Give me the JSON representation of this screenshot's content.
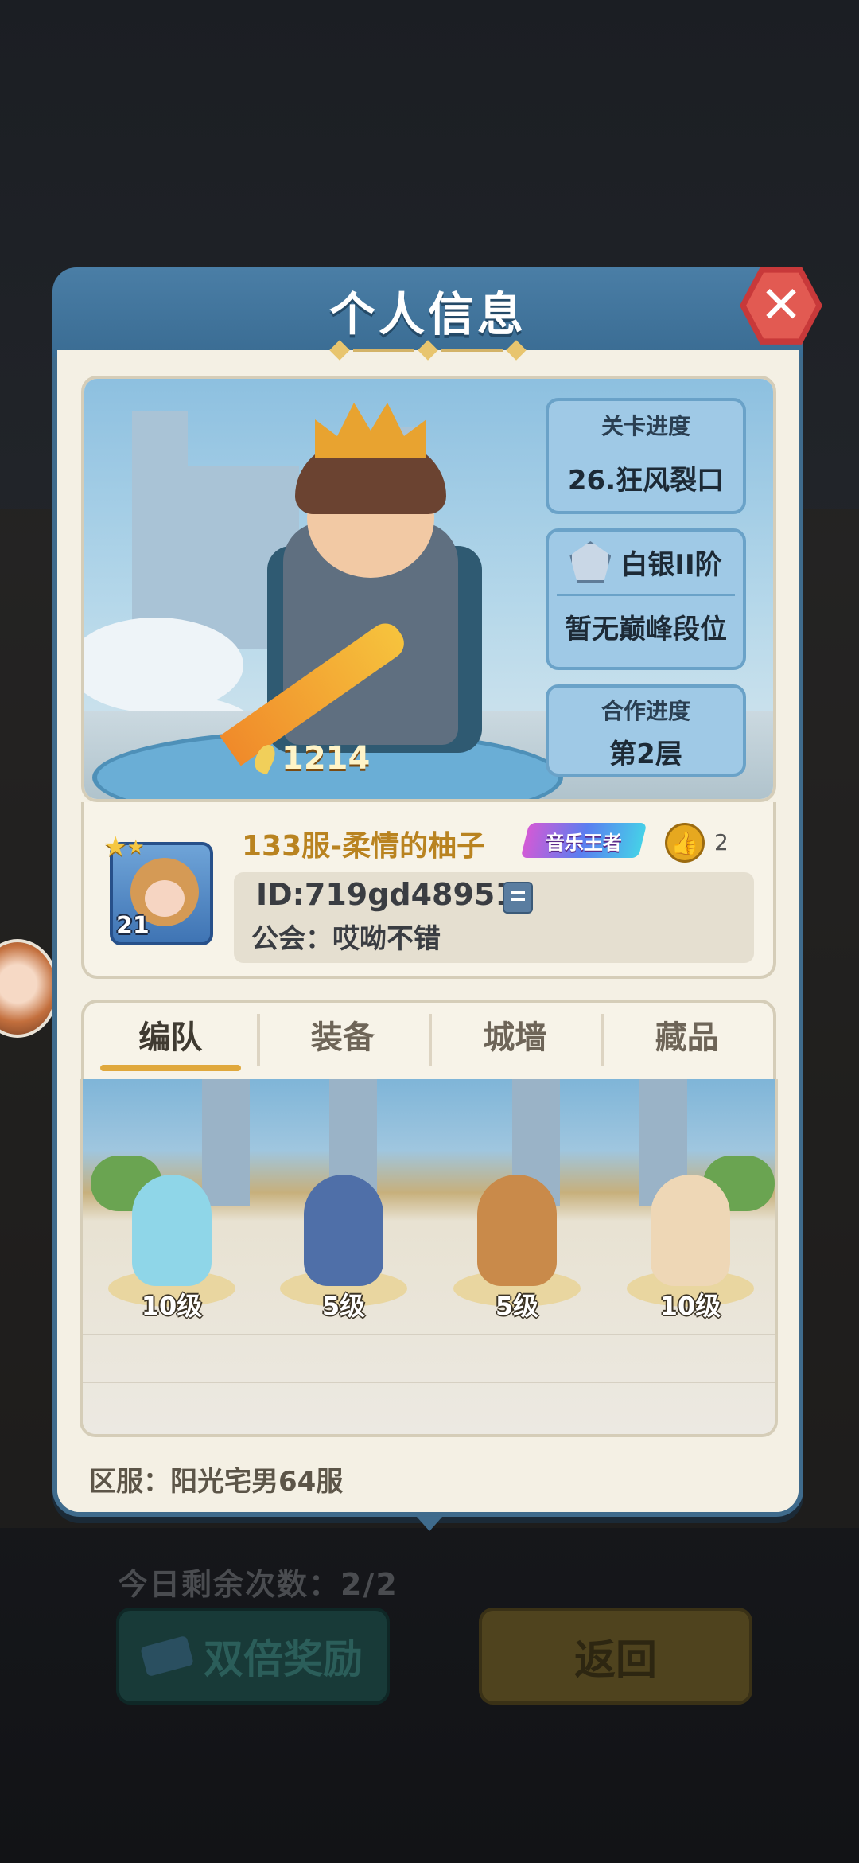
{
  "panel": {
    "title": "个人信息"
  },
  "stats": {
    "stage_label": "关卡进度",
    "stage_value": "26.狂风裂口",
    "rank_value": "白银II阶",
    "peak_value": "暂无巅峰段位",
    "coop_label": "合作进度",
    "coop_value": "第2层"
  },
  "hero": {
    "power": "1214"
  },
  "player": {
    "avatar_level": "21",
    "name": "133服-柔情的柚子",
    "title_badge": "音乐王者",
    "likes": "2",
    "id": "ID:719gd48951",
    "guild": "公会：哎呦不错"
  },
  "tabs": [
    {
      "label": "编队",
      "active": true
    },
    {
      "label": "装备",
      "active": false
    },
    {
      "label": "城墙",
      "active": false
    },
    {
      "label": "藏品",
      "active": false
    }
  ],
  "team": [
    {
      "level": "10级",
      "color": "#8fd6e8"
    },
    {
      "level": "5级",
      "color": "#4f6fa8"
    },
    {
      "level": "5级",
      "color": "#c98a4a"
    },
    {
      "level": "10级",
      "color": "#eed7b6"
    }
  ],
  "server": "区服：阳光宅男64服",
  "background": {
    "remaining": "今日剩余次数：2/2",
    "double_reward": "双倍奖励",
    "back": "返回"
  },
  "colors": {
    "panel_header": "#3f6b8c",
    "close_button": "#d9473f",
    "accent_gold": "#e0a83c"
  }
}
